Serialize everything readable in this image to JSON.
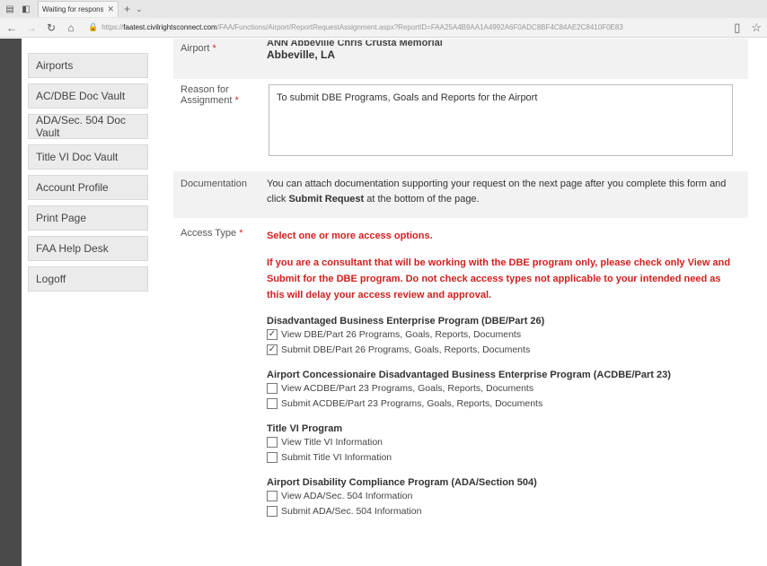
{
  "browser": {
    "tab_title": "Waiting for response fr",
    "url_domain": "faatest.civilrightsconnect.com",
    "url_path": "/FAA/Functions/Airport/ReportRequestAssignment.aspx?ReportID=FAA25A4B9AA1A4992A6F0ADC8BF4C84AE2C8410F0E83"
  },
  "sidebar": {
    "items": [
      {
        "label": "Airports"
      },
      {
        "label": "AC/DBE Doc Vault"
      },
      {
        "label": "ADA/Sec. 504 Doc Vault"
      },
      {
        "label": "Title VI Doc Vault"
      },
      {
        "label": "Account Profile"
      },
      {
        "label": "Print Page"
      },
      {
        "label": "FAA Help Desk"
      },
      {
        "label": "Logoff"
      }
    ]
  },
  "form": {
    "airport": {
      "label": "Airport",
      "required_mark": "*",
      "cut_text": "ANN Abbeville Chris Crusta Memorial",
      "value": "Abbeville, LA"
    },
    "reason": {
      "label": "Reason for Assignment",
      "required_mark": "*",
      "value": "To submit DBE Programs, Goals and Reports for the Airport"
    },
    "documentation": {
      "label": "Documentation",
      "text_part1": "You can attach documentation supporting your request on the next page after you complete this form and click ",
      "text_bold": "Submit Request",
      "text_part2": " at the bottom of the page."
    },
    "access": {
      "label": "Access Type",
      "required_mark": "*",
      "select_prompt": "Select one or more access options.",
      "consultant_note": "If you are a consultant that will be working with the DBE program only, please check only View and Submit for the DBE program. Do not check access types not applicable to your intended need as this will delay your access review and approval.",
      "groups": [
        {
          "title": "Disadvantaged Business Enterprise Program (DBE/Part 26)",
          "options": [
            {
              "label": "View DBE/Part 26 Programs, Goals, Reports, Documents",
              "checked": true
            },
            {
              "label": "Submit DBE/Part 26 Programs, Goals, Reports, Documents",
              "checked": true
            }
          ]
        },
        {
          "title": "Airport Concessionaire Disadvantaged Business Enterprise Program (ACDBE/Part 23)",
          "options": [
            {
              "label": "View ACDBE/Part 23 Programs, Goals, Reports, Documents",
              "checked": false
            },
            {
              "label": "Submit ACDBE/Part 23 Programs, Goals, Reports, Documents",
              "checked": false
            }
          ]
        },
        {
          "title": "Title VI Program",
          "options": [
            {
              "label": "View Title VI Information",
              "checked": false
            },
            {
              "label": "Submit Title VI Information",
              "checked": false
            }
          ]
        },
        {
          "title": "Airport Disability Compliance Program (ADA/Section 504)",
          "options": [
            {
              "label": "View ADA/Sec. 504 Information",
              "checked": false
            },
            {
              "label": "Submit ADA/Sec. 504 Information",
              "checked": false
            }
          ]
        }
      ]
    }
  },
  "colors": {
    "required": "#c9302c",
    "warning": "#d21f1f",
    "row_shade": "#f2f2f2",
    "sidebar_bg": "#ebebeb"
  }
}
